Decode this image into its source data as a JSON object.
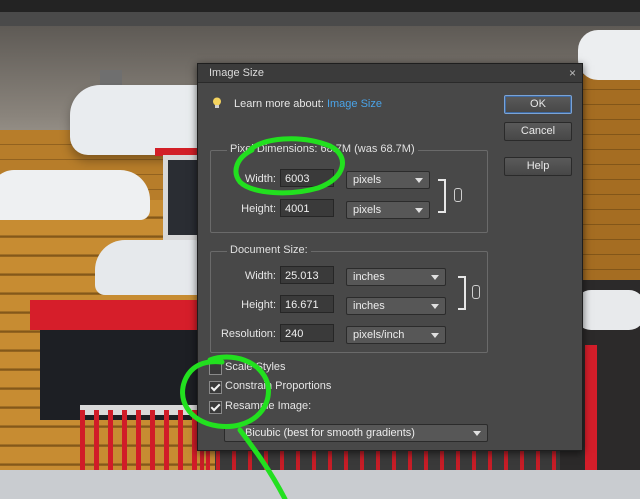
{
  "dialog": {
    "title": "Image Size",
    "close_glyph": "×",
    "learn_prefix": "Learn more about:",
    "learn_link": "Image Size",
    "buttons": {
      "ok": "OK",
      "cancel": "Cancel",
      "help": "Help"
    }
  },
  "pixel_dimensions": {
    "label": "Pixel Dimensions: 68.7M (was 68.7M)",
    "width_label": "Width:",
    "width_value": "6003",
    "width_unit": "pixels",
    "height_label": "Height:",
    "height_value": "4001",
    "height_unit": "pixels"
  },
  "document_size": {
    "label": "Document Size:",
    "width_label": "Width:",
    "width_value": "25.013",
    "width_unit": "inches",
    "height_label": "Height:",
    "height_value": "16.671",
    "height_unit": "inches",
    "resolution_label": "Resolution:",
    "resolution_value": "240",
    "resolution_unit": "pixels/inch"
  },
  "options": {
    "scale_styles": {
      "label": "Scale Styles",
      "checked": false
    },
    "constrain": {
      "label": "Constrain Proportions",
      "checked": true
    },
    "resample": {
      "label": "Resample Image:",
      "checked": true
    },
    "resample_method": "Bicubic (best for smooth gradients)"
  },
  "colors": {
    "annotation": "#22e01f",
    "link": "#4aa3e8",
    "dialog_bg": "#484848"
  }
}
